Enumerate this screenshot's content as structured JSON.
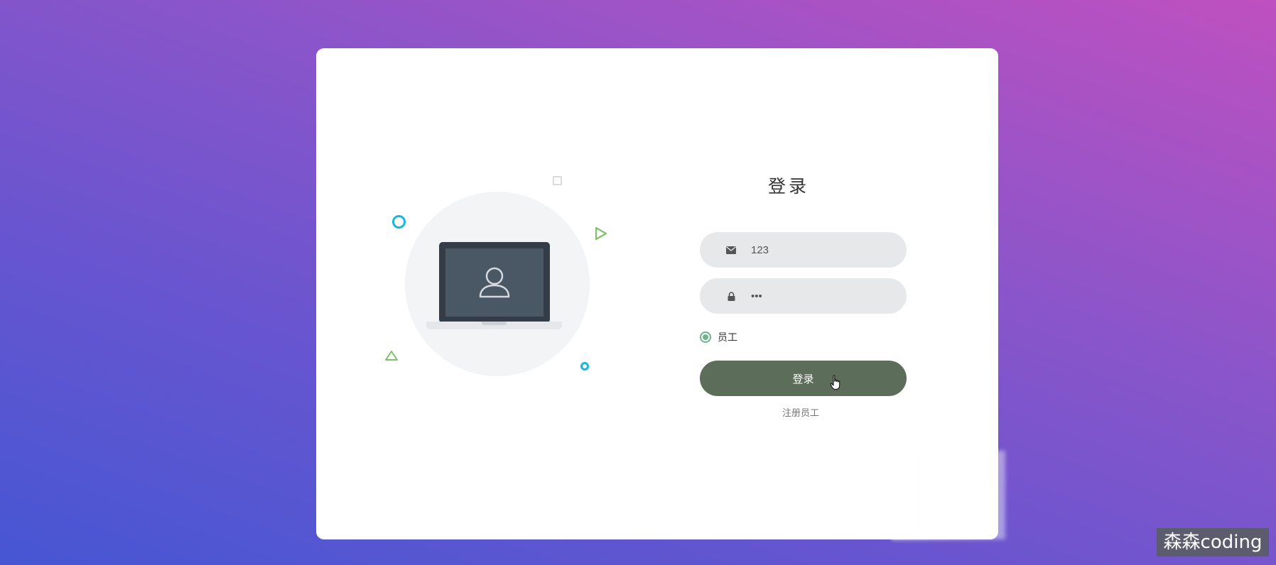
{
  "login": {
    "title": "登录",
    "email_value": "123",
    "password_value": "•••",
    "role_option": "员工",
    "submit_label": "登录",
    "register_label": "注册员工"
  },
  "watermark": "森森coding",
  "colors": {
    "button_bg": "#5c6e59",
    "radio_accent": "#6bb48e",
    "field_bg": "#e7e8e9",
    "deco_blue": "#18b6e0",
    "deco_green": "#7fc16a"
  }
}
